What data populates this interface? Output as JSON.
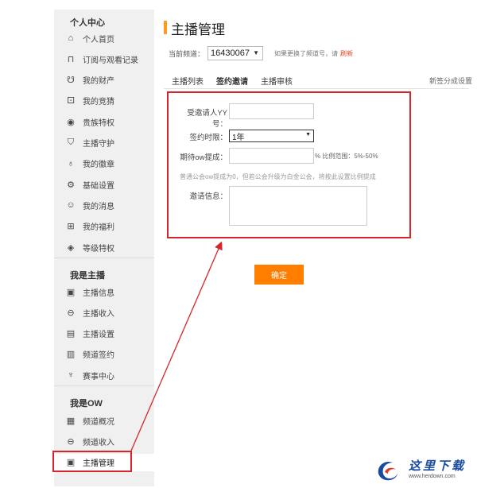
{
  "sidebar": {
    "section_personal": "个人中心",
    "personal_items": [
      {
        "label": "个人首页",
        "icon": "home-icon",
        "glyph": "⌂"
      },
      {
        "label": "订阅与观看记录",
        "icon": "bookmark-icon",
        "glyph": "⊓"
      },
      {
        "label": "我的财产",
        "icon": "money-bag-icon",
        "glyph": "☋"
      },
      {
        "label": "我的竞猜",
        "icon": "dice-icon",
        "glyph": "⚀"
      },
      {
        "label": "贵族特权",
        "icon": "noble-badge-icon",
        "glyph": "◉"
      },
      {
        "label": "主播守护",
        "icon": "shield-icon",
        "glyph": "⛉"
      },
      {
        "label": "我的徽章",
        "icon": "medal-icon",
        "glyph": "♁"
      },
      {
        "label": "基础设置",
        "icon": "gear-icon",
        "glyph": "⚙"
      },
      {
        "label": "我的消息",
        "icon": "message-icon",
        "glyph": "☺"
      },
      {
        "label": "我的福利",
        "icon": "gift-icon",
        "glyph": "⊞"
      },
      {
        "label": "等级特权",
        "icon": "diamond-icon",
        "glyph": "◈"
      }
    ],
    "section_anchor": "我是主播",
    "anchor_items": [
      {
        "label": "主播信息",
        "icon": "id-card-icon",
        "glyph": "▣"
      },
      {
        "label": "主播收入",
        "icon": "income-icon",
        "glyph": "⊖"
      },
      {
        "label": "主播设置",
        "icon": "user-settings-icon",
        "glyph": "▤"
      },
      {
        "label": "频道签约",
        "icon": "contract-icon",
        "glyph": "▥"
      },
      {
        "label": "赛事中心",
        "icon": "trophy-icon",
        "glyph": "♆"
      }
    ],
    "section_ow": "我是OW",
    "ow_items": [
      {
        "label": "频道概况",
        "icon": "overview-icon",
        "glyph": "▦"
      },
      {
        "label": "频道收入",
        "icon": "channel-income-icon",
        "glyph": "⊖"
      },
      {
        "label": "主播管理",
        "icon": "anchor-manage-icon",
        "glyph": "▣"
      }
    ]
  },
  "main": {
    "title": "主播管理",
    "channel_label": "当前频道：",
    "channel_value": "16430067",
    "channel_hint": "如果更换了频道号，请",
    "refresh_link": "刷新",
    "tabs": [
      "主播列表",
      "签约邀请",
      "主播审核"
    ],
    "active_tab": 1,
    "new_setting": "新签分成设置"
  },
  "form": {
    "invitee_label": "受邀请人YY号：",
    "invitee_value": "",
    "term_label": "签约时限：",
    "term_value": "1年",
    "ow_label": "期待ow提成：",
    "ow_value": "",
    "ow_range": "% 比例范围：5%-50%",
    "note": "普通公会ow提成为0，但若公会升级为白金公会，将按此设置比例提成",
    "message_label": "邀请信息：",
    "message_value": ""
  },
  "confirm_label": "确定",
  "watermark": {
    "text": "这里下载",
    "url": "www.herdown.com"
  },
  "colors": {
    "accent": "#ff9a1f",
    "button": "#ff7e00",
    "annotation": "#d7262b",
    "logo_blue": "#1a4aa0"
  }
}
